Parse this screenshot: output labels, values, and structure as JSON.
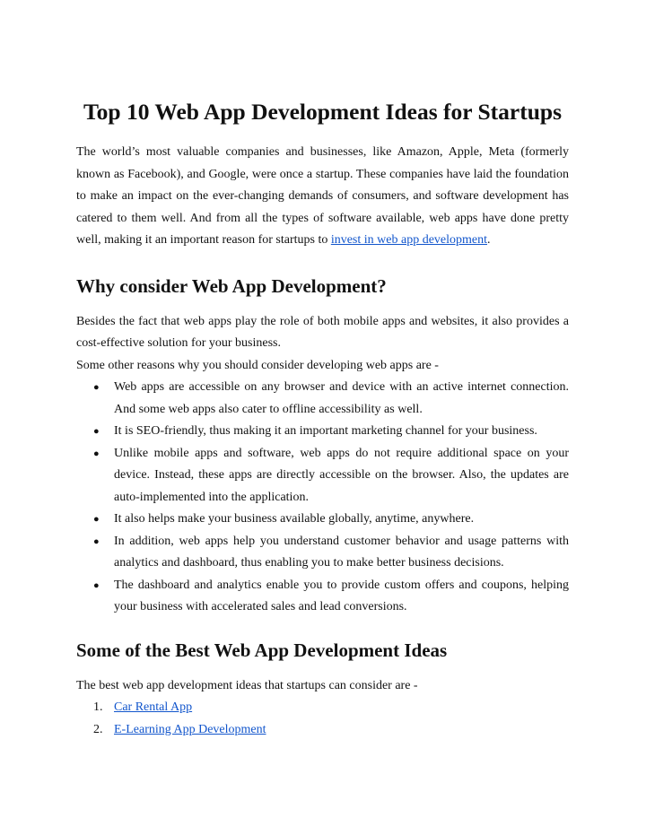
{
  "title": "Top 10 Web App Development Ideas for Startups",
  "intro": {
    "text": "The world’s most valuable companies and businesses, like Amazon, Apple, Meta (formerly known as Facebook), and Google, were once a startup. These companies have laid the foundation to make an impact on the ever-changing demands of consumers, and software development has catered to them well. And from all the types of software available, web apps have done pretty well, making it an important reason for startups to ",
    "link_text": "invest in web app development",
    "after_link": "."
  },
  "section1": {
    "heading": "Why consider Web App Development?",
    "paragraph1": "Besides the fact that web apps play the role of both mobile apps and websites, it also provides a cost-effective solution for your business.",
    "paragraph2": "Some other reasons why you should consider developing web apps are -",
    "bullet_symbol": "●",
    "bullets": [
      "Web apps are accessible on any browser and device with an active internet connection. And some web apps also cater to offline accessibility as well.",
      "It is SEO-friendly, thus making it an important marketing channel for your business.",
      "Unlike mobile apps and software, web apps do not require additional space on your device. Instead, these apps are directly accessible on the browser. Also, the updates are auto-implemented into the application.",
      "It also helps make your business available globally, anytime, anywhere.",
      "In addition, web apps help you understand customer behavior and usage patterns with analytics and dashboard, thus enabling you to make better business decisions.",
      "The dashboard and analytics enable you to provide custom offers and coupons, helping your business with accelerated sales and lead conversions."
    ]
  },
  "section2": {
    "heading": "Some of the Best Web App Development Ideas",
    "paragraph": "The best web app development ideas that startups can consider are -",
    "items": [
      {
        "number": "1.",
        "label": "Car Rental App"
      },
      {
        "number": "2.",
        "label": "E-Learning App Development"
      }
    ]
  },
  "colors": {
    "text": "#111111",
    "link": "#1155cc",
    "background": "#ffffff"
  }
}
